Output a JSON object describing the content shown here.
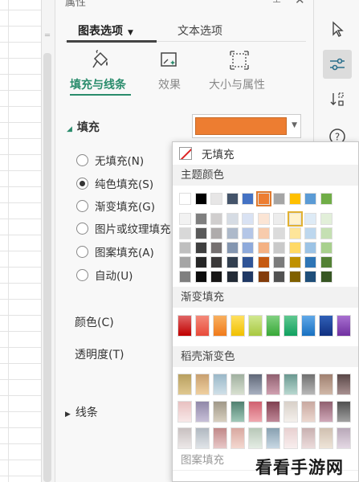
{
  "panel": {
    "title": "属性",
    "tabs": [
      {
        "label": "图表选项",
        "active": true
      },
      {
        "label": "文本选项",
        "active": false
      }
    ],
    "subtabs": [
      {
        "label": "填充与线条",
        "icon": "paint-bucket-icon",
        "active": true
      },
      {
        "label": "效果",
        "icon": "effects-icon",
        "active": false
      },
      {
        "label": "大小与属性",
        "icon": "size-properties-icon",
        "active": false
      }
    ],
    "fill_section": "填充",
    "fill_options": [
      {
        "label": "无填充(N)",
        "selected": false
      },
      {
        "label": "纯色填充(S)",
        "selected": true
      },
      {
        "label": "渐变填充(G)",
        "selected": false
      },
      {
        "label": "图片或纹理填充",
        "selected": false
      },
      {
        "label": "图案填充(A)",
        "selected": false
      },
      {
        "label": "自动(U)",
        "selected": false
      }
    ],
    "color_label": "颜色(C)",
    "transparency_label": "透明度(T)",
    "lines_section": "线条",
    "current_color": "#ed7d31"
  },
  "popup": {
    "no_fill": "无填充",
    "theme_colors_label": "主题颜色",
    "gradient_fill_label": "渐变填充",
    "shell_gradient_label": "稻壳渐变色",
    "pattern_fill_label": "图案填充",
    "theme_colors": [
      [
        "#ffffff",
        "#000000",
        "#e7e6e6",
        "#44546a",
        "#4472c4",
        "#ed7d31",
        "#a5a5a5",
        "#ffc000",
        "#5b9bd5",
        "#70ad47"
      ],
      [
        "#f2f2f2",
        "#7f7f7f",
        "#d0cece",
        "#d6dce4",
        "#d9e2f3",
        "#fbe5d5",
        "#ededed",
        "#fff2cc",
        "#deebf6",
        "#e2efd9"
      ],
      [
        "#d8d8d8",
        "#595959",
        "#aeabab",
        "#adb9ca",
        "#b4c6e7",
        "#f7cbac",
        "#dbdbdb",
        "#fee599",
        "#bdd7ee",
        "#c5e0b3"
      ],
      [
        "#bfbfbf",
        "#3f3f3f",
        "#757070",
        "#8496b0",
        "#8eaadb",
        "#f4b183",
        "#c9c9c9",
        "#ffd965",
        "#9cc3e5",
        "#a8d08d"
      ],
      [
        "#a5a5a5",
        "#262626",
        "#3a3838",
        "#323f4f",
        "#2f5496",
        "#c55a11",
        "#7b7b7b",
        "#bf9000",
        "#2e75b5",
        "#538135"
      ],
      [
        "#7f7f7f",
        "#0c0c0c",
        "#171616",
        "#222a35",
        "#1f3864",
        "#833c0b",
        "#525252",
        "#7f6000",
        "#1e4e79",
        "#375623"
      ]
    ],
    "gradients": [
      [
        "#c00000",
        "#e06666"
      ],
      [
        "#e84a3a",
        "#f48a7a"
      ],
      [
        "#f07a1a",
        "#f8b060"
      ],
      [
        "#f0c000",
        "#ffe060"
      ],
      [
        "#a8c840",
        "#d0e890"
      ],
      [
        "#38a838",
        "#80d080"
      ],
      [
        "#10a060",
        "#60c890"
      ],
      [
        "#1870c0",
        "#60a8e8"
      ],
      [
        "#103080",
        "#3060b8"
      ],
      [
        "#7030a0",
        "#a870d0"
      ]
    ],
    "shell_gradients": [
      [
        "#b8a060",
        "#e0c890"
      ],
      [
        "#c8a070",
        "#f0d0a0"
      ],
      [
        "#9ab8c8",
        "#d0e0e8"
      ],
      [
        "#a0b0a0",
        "#d8e0d0"
      ],
      [
        "#606878",
        "#a8b0c0"
      ],
      [
        "#906070",
        "#d0a0b0"
      ],
      [
        "#6a9890",
        "#b8d8d0"
      ],
      [
        "#707070",
        "#b8b8b8"
      ],
      [
        "#a08070",
        "#d0b8a8"
      ],
      [
        "#5a4848",
        "#a89090"
      ],
      [
        "#e8c0c0",
        "#f8e8e8"
      ],
      [
        "#9088a8",
        "#c8c0d8"
      ],
      [
        "#a09888",
        "#d8d0c0"
      ],
      [
        "#508070",
        "#a0c8b8"
      ],
      [
        "#d06070",
        "#f0a8b0"
      ],
      [
        "#804050",
        "#c08898"
      ],
      [
        "#d8d0c8",
        "#f4f0ec"
      ],
      [
        "#c8a8a0",
        "#ecd8d0"
      ],
      [
        "#906070",
        "#d0a8b8"
      ],
      [
        "#505050",
        "#a0a0a0"
      ],
      [
        "#c8c0c0",
        "#ece8e8"
      ],
      [
        "#b0b8c0",
        "#e0e4e8"
      ],
      [
        "#c08888",
        "#e8c8c8"
      ],
      [
        "#d8a8a0",
        "#f4d8d0"
      ],
      [
        "#b8c8b8",
        "#e4ece4"
      ],
      [
        "#88a0b0",
        "#c8d8e4"
      ],
      [
        "#e8d0d0",
        "#f8eeee"
      ],
      [
        "#c8b0b0",
        "#ecdcdc"
      ],
      [
        "#d0c0b0",
        "#eee4d8"
      ],
      [
        "#b8a8b8",
        "#e4d8e4"
      ]
    ],
    "selected_theme_cell": [
      0,
      5
    ],
    "hover_theme_cell": [
      1,
      7
    ]
  },
  "toolbar": {
    "items": [
      {
        "icon": "select-pointer-icon"
      },
      {
        "icon": "settings-sliders-icon",
        "active": true
      },
      {
        "icon": "sort-order-icon"
      },
      {
        "icon": "help-icon"
      }
    ]
  },
  "watermark": "看看手游网"
}
